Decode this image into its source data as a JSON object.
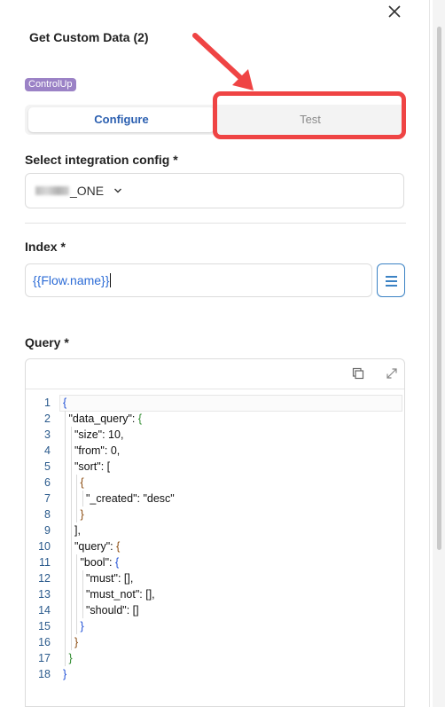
{
  "dialog": {
    "title": "Get Custom Data (2)",
    "badge": "ControlUp"
  },
  "tabs": [
    {
      "label": "Configure",
      "active": true
    },
    {
      "label": "Test",
      "active": false
    }
  ],
  "integration": {
    "label": "Select integration config *",
    "value_suffix": "_ONE"
  },
  "index": {
    "label": "Index *",
    "value": "{{Flow.name}}"
  },
  "query": {
    "label": "Query *",
    "lines": [
      {
        "n": "1",
        "depth": 0,
        "parts": [
          {
            "t": "{",
            "c": "b1"
          }
        ]
      },
      {
        "n": "2",
        "depth": 1,
        "parts": [
          {
            "t": "\"data_query\": "
          },
          {
            "t": "{",
            "c": "b2"
          }
        ]
      },
      {
        "n": "3",
        "depth": 2,
        "parts": [
          {
            "t": "\"size\": 10,"
          }
        ]
      },
      {
        "n": "4",
        "depth": 2,
        "parts": [
          {
            "t": "\"from\": 0,"
          }
        ]
      },
      {
        "n": "5",
        "depth": 2,
        "parts": [
          {
            "t": "\"sort\": "
          },
          {
            "t": "[",
            "c": ""
          }
        ]
      },
      {
        "n": "6",
        "depth": 3,
        "parts": [
          {
            "t": "{",
            "c": "b3"
          }
        ]
      },
      {
        "n": "7",
        "depth": 4,
        "parts": [
          {
            "t": "\"_created\": \"desc\""
          }
        ]
      },
      {
        "n": "8",
        "depth": 3,
        "parts": [
          {
            "t": "}",
            "c": "b3"
          }
        ]
      },
      {
        "n": "9",
        "depth": 2,
        "parts": [
          {
            "t": "],"
          }
        ]
      },
      {
        "n": "10",
        "depth": 2,
        "parts": [
          {
            "t": "\"query\": "
          },
          {
            "t": "{",
            "c": "b3"
          }
        ]
      },
      {
        "n": "11",
        "depth": 3,
        "parts": [
          {
            "t": "\"bool\": "
          },
          {
            "t": "{",
            "c": "b1"
          }
        ]
      },
      {
        "n": "12",
        "depth": 4,
        "parts": [
          {
            "t": "\"must\": [],"
          }
        ]
      },
      {
        "n": "13",
        "depth": 4,
        "parts": [
          {
            "t": "\"must_not\": [],"
          }
        ]
      },
      {
        "n": "14",
        "depth": 4,
        "parts": [
          {
            "t": "\"should\": []"
          }
        ]
      },
      {
        "n": "15",
        "depth": 3,
        "parts": [
          {
            "t": "}",
            "c": "b1"
          }
        ]
      },
      {
        "n": "16",
        "depth": 2,
        "parts": [
          {
            "t": "}",
            "c": "b3"
          }
        ]
      },
      {
        "n": "17",
        "depth": 1,
        "parts": [
          {
            "t": "}",
            "c": "b2"
          }
        ]
      },
      {
        "n": "18",
        "depth": 0,
        "parts": [
          {
            "t": "}",
            "c": "b1"
          }
        ]
      }
    ]
  },
  "colors": {
    "accent": "#2b5fb0",
    "badge": "#9b82c6",
    "highlight": "#ef4444"
  },
  "icons": [
    "close-icon",
    "chevron-down-icon",
    "menu-icon",
    "copy-icon",
    "expand-icon",
    "arrow-annotation"
  ]
}
